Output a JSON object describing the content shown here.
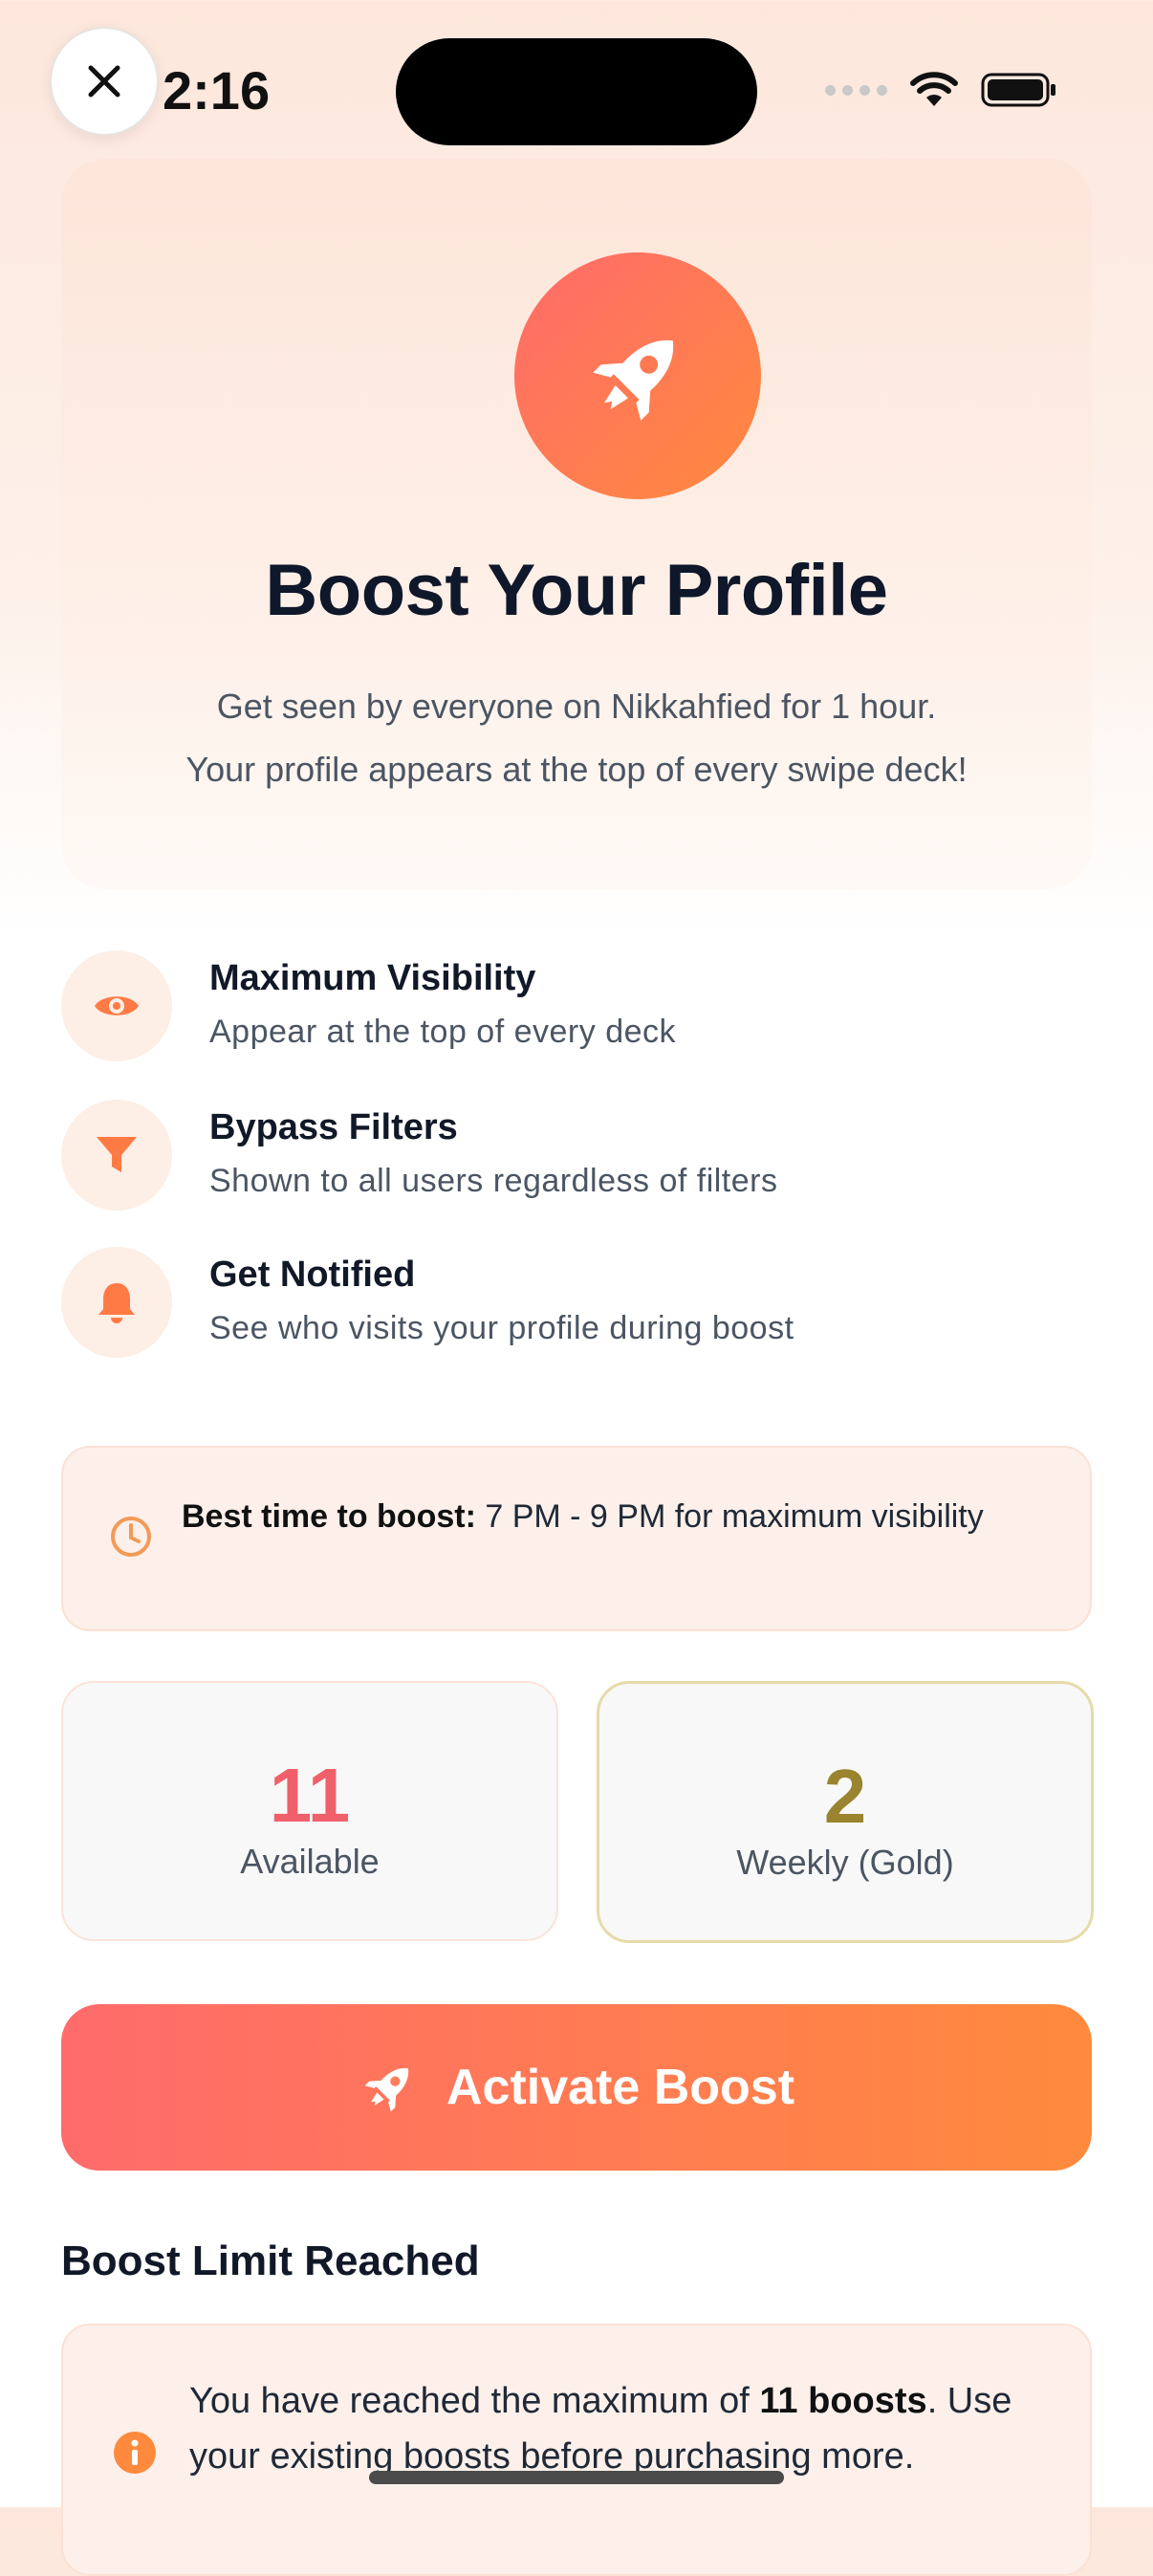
{
  "status_bar": {
    "time": "2:16",
    "close_icon": "close-icon",
    "wifi_icon": "wifi-icon",
    "battery_icon": "battery-icon"
  },
  "hero": {
    "icon": "rocket-icon",
    "title": "Boost Your Profile",
    "subtitle_line1": "Get seen by everyone on Nikkahfied for 1 hour.",
    "subtitle_line2": "Your profile appears at the top of every swipe deck!"
  },
  "features": [
    {
      "icon": "eye-icon",
      "title": "Maximum Visibility",
      "description": "Appear at the top of every deck"
    },
    {
      "icon": "filter-icon",
      "title": "Bypass Filters",
      "description": "Shown to all users regardless of filters"
    },
    {
      "icon": "bell-icon",
      "title": "Get Notified",
      "description": "See who visits your profile during boost"
    }
  ],
  "tip": {
    "icon": "clock-icon",
    "label": "Best time to boost:",
    "text": " 7 PM - 9 PM for maximum visibility"
  },
  "stats": {
    "available": {
      "value": "11",
      "label": "Available"
    },
    "weekly": {
      "value": "2",
      "label": "Weekly (Gold)"
    }
  },
  "activate_button": {
    "icon": "rocket-icon",
    "label": "Activate Boost"
  },
  "limit": {
    "title": "Boost Limit Reached",
    "icon": "info-icon",
    "text_before": "You have reached the maximum of ",
    "text_bold": "11 boosts",
    "text_after": ". Use your existing boosts before purchasing more."
  },
  "colors": {
    "accent_start": "#ff6b6b",
    "accent_end": "#ff8a3d",
    "available_number": "#f0606a",
    "gold_number": "#9a8430",
    "gold_border": "#e6dba8"
  }
}
